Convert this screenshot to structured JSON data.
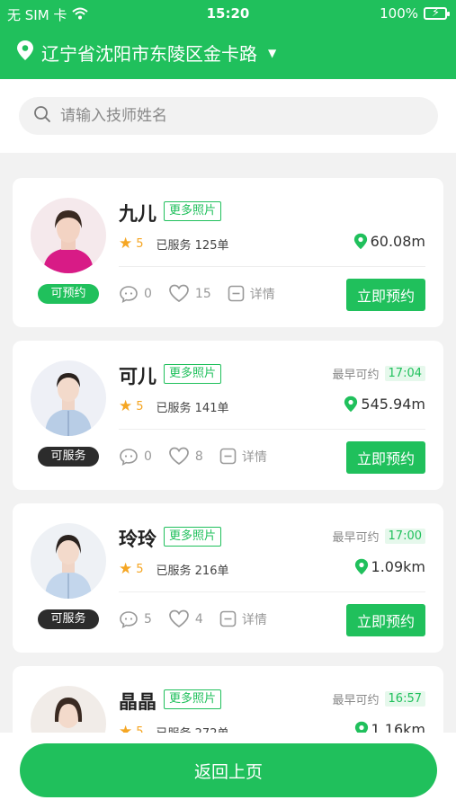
{
  "status_bar": {
    "carrier": "无 SIM 卡",
    "time": "15:20",
    "battery": "100%"
  },
  "header": {
    "location": "辽宁省沈阳市东陵区金卡路"
  },
  "search": {
    "placeholder": "请输入技师姓名"
  },
  "common": {
    "more_photos": "更多照片",
    "earliest_label": "最早可约",
    "detail_label": "详情",
    "book_label": "立即预约"
  },
  "technicians": [
    {
      "name": "九儿",
      "status": "可预约",
      "rating": "5",
      "served": "已服务 125单",
      "distance": "60.08m",
      "earliest_time": "",
      "comments": "0",
      "likes": "15"
    },
    {
      "name": "可儿",
      "status": "可服务",
      "rating": "5",
      "served": "已服务 141单",
      "distance": "545.94m",
      "earliest_time": "17:04",
      "comments": "0",
      "likes": "8"
    },
    {
      "name": "玲玲",
      "status": "可服务",
      "rating": "5",
      "served": "已服务 216单",
      "distance": "1.09km",
      "earliest_time": "17:00",
      "comments": "5",
      "likes": "4"
    },
    {
      "name": "晶晶",
      "status": "",
      "rating": "5",
      "served": "已服务 272单",
      "distance": "1.16km",
      "earliest_time": "16:57",
      "comments": "",
      "likes": ""
    }
  ],
  "footer": {
    "back_label": "返回上页"
  },
  "colors": {
    "brand": "#20c05c",
    "star": "#f5a623",
    "dark_pill": "#2c2c2c"
  }
}
